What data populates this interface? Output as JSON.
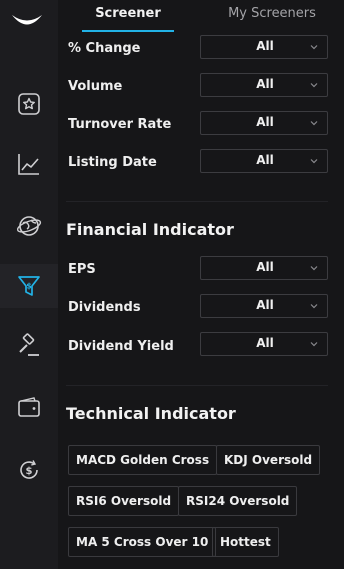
{
  "tabs": {
    "screener": "Screener",
    "my_screeners": "My Screeners"
  },
  "filters_top": [
    {
      "label": "% Change",
      "value": "All"
    },
    {
      "label": "Volume",
      "value": "All"
    },
    {
      "label": "Turnover Rate",
      "value": "All"
    },
    {
      "label": "Listing Date",
      "value": "All"
    }
  ],
  "financial": {
    "title": "Financial Indicator",
    "rows": [
      {
        "label": "EPS",
        "value": "All"
      },
      {
        "label": "Dividends",
        "value": "All"
      },
      {
        "label": "Dividend Yield",
        "value": "All"
      }
    ]
  },
  "technical": {
    "title": "Technical Indicator",
    "chips": [
      "MACD Golden Cross",
      "KDJ Oversold",
      "RSI6 Oversold",
      "RSI24 Oversold",
      "MA 5 Cross Over 10",
      "Hottest"
    ]
  },
  "sidebar_icons": [
    "moomoo-logo-icon",
    "star-watchlist-icon",
    "line-chart-icon",
    "globe-markets-icon",
    "dollar-filter-icon",
    "gavel-auction-icon",
    "wallet-icon",
    "dollar-refresh-icon"
  ],
  "colors": {
    "accent": "#22b2e6",
    "background": "#161618",
    "sidebar": "#1c1c1f"
  }
}
